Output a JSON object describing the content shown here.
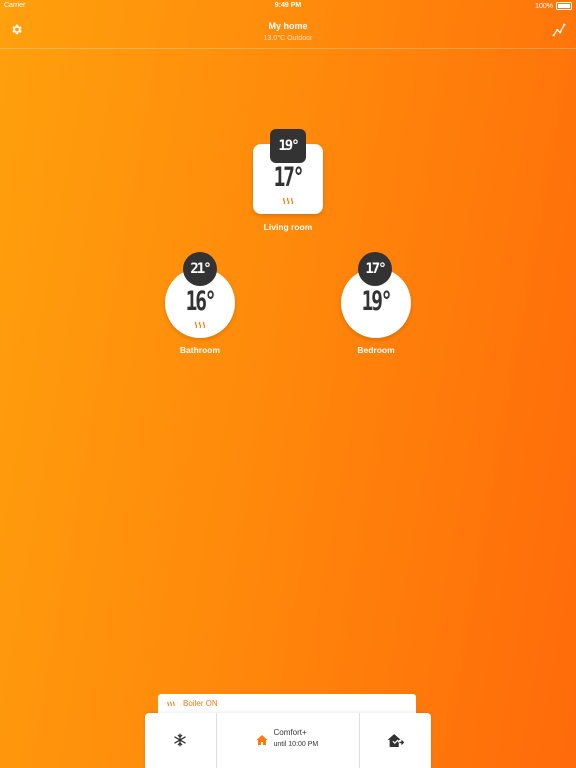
{
  "status_bar": {
    "carrier": "Carrier",
    "time": "9:49 PM",
    "battery": "100%"
  },
  "header": {
    "title": "My home",
    "subtitle": "13.0°C Outdoor"
  },
  "rooms": [
    {
      "name": "Living room",
      "setpoint": "19°",
      "current": "17°",
      "heating": true
    },
    {
      "name": "Bathroom",
      "setpoint": "21°",
      "current": "16°",
      "heating": true
    },
    {
      "name": "Bedroom",
      "setpoint": "17°",
      "current": "19°",
      "heating": false
    }
  ],
  "boiler": {
    "label": "Boiler ON"
  },
  "mode": {
    "title": "Comfort+",
    "subtitle": "until 10:00 PM"
  },
  "icons": {
    "settings": "gear-icon",
    "graph": "graph-icon",
    "frost": "snowflake-icon",
    "home": "home-icon",
    "away": "away-icon"
  },
  "colors": {
    "accent": "#ff7a0a",
    "device_dark": "#333333"
  }
}
